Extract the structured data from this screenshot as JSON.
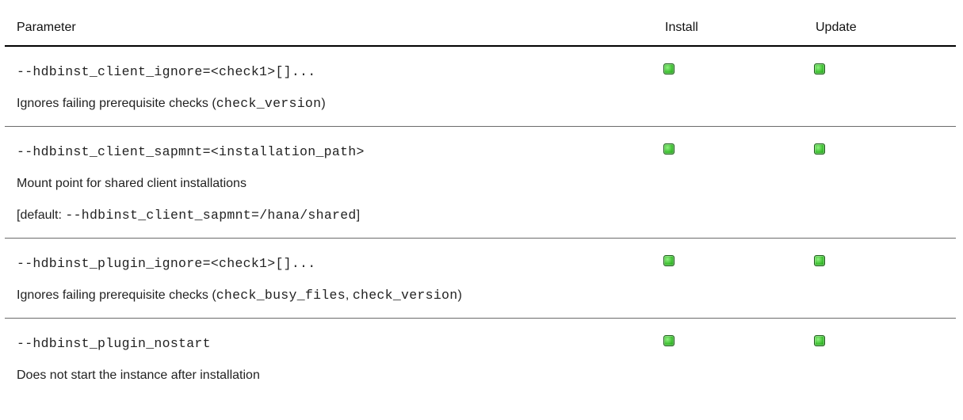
{
  "columns": {
    "parameter": "Parameter",
    "install": "Install",
    "update": "Update"
  },
  "rows": [
    {
      "lines": [
        {
          "style": "code",
          "segments": [
            {
              "type": "code",
              "text": "--hdbinst_client_ignore=<check1>[]..."
            }
          ]
        },
        {
          "style": "text",
          "segments": [
            {
              "type": "text",
              "text": "Ignores failing prerequisite checks ("
            },
            {
              "type": "code",
              "text": "check_version"
            },
            {
              "type": "text",
              "text": ")"
            }
          ]
        }
      ],
      "install": true,
      "update": true
    },
    {
      "lines": [
        {
          "style": "code",
          "segments": [
            {
              "type": "code",
              "text": "--hdbinst_client_sapmnt=<installation_path>"
            }
          ]
        },
        {
          "style": "text",
          "segments": [
            {
              "type": "text",
              "text": "Mount point for shared client installations"
            }
          ]
        },
        {
          "style": "text",
          "segments": [
            {
              "type": "text",
              "text": "[default: "
            },
            {
              "type": "code",
              "text": "--hdbinst_client_sapmnt=/hana/shared"
            },
            {
              "type": "text",
              "text": "]"
            }
          ]
        }
      ],
      "install": true,
      "update": true
    },
    {
      "lines": [
        {
          "style": "code",
          "segments": [
            {
              "type": "code",
              "text": "--hdbinst_plugin_ignore=<check1>[]..."
            }
          ]
        },
        {
          "style": "text",
          "segments": [
            {
              "type": "text",
              "text": "Ignores failing prerequisite checks ("
            },
            {
              "type": "code",
              "text": "check_busy_files"
            },
            {
              "type": "text",
              "text": ", "
            },
            {
              "type": "code",
              "text": "check_version"
            },
            {
              "type": "text",
              "text": ")"
            }
          ]
        }
      ],
      "install": true,
      "update": true
    },
    {
      "lines": [
        {
          "style": "code",
          "segments": [
            {
              "type": "code",
              "text": "--hdbinst_plugin_nostart"
            }
          ]
        },
        {
          "style": "text",
          "segments": [
            {
              "type": "text",
              "text": "Does not start the instance after installation"
            }
          ]
        }
      ],
      "install": true,
      "update": true
    }
  ],
  "indicator_icon": "green-square-icon",
  "indicator_color": "#3fbf33"
}
